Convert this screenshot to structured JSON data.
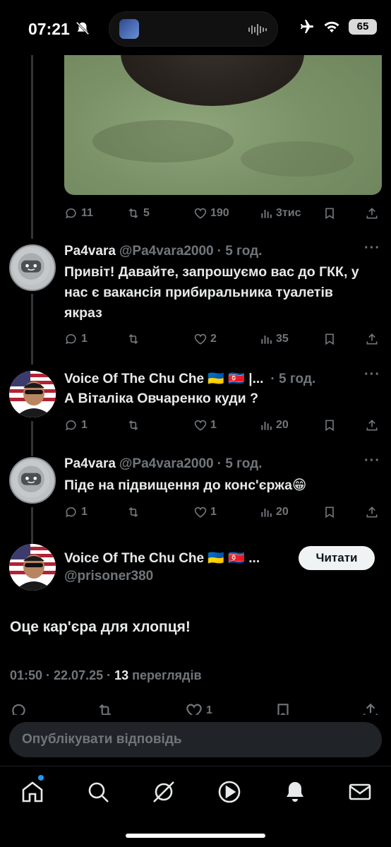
{
  "status_bar": {
    "time": "07:21",
    "battery": "65",
    "icons": [
      "bell-slash-icon",
      "airplane-icon",
      "wifi-icon",
      "battery-icon"
    ]
  },
  "colors": {
    "background": "#000000",
    "text_primary": "#e7e9ea",
    "text_secondary": "#71767b",
    "accent": "#1d9bf0"
  },
  "photo_post": {
    "actions": {
      "replies": "11",
      "reposts": "5",
      "likes": "190",
      "views": "3тис"
    }
  },
  "replies": [
    {
      "name": "Pa4vara",
      "handle": "@Pa4vara2000",
      "time": "· 5 год.",
      "text": "Привіт! Давайте, запрошуємо вас до ГКК, у нас є вакансія прибиральника туалетів якраз",
      "actions": {
        "replies": "1",
        "reposts": "",
        "likes": "2",
        "views": "35"
      }
    },
    {
      "name": "Voice Of The Chu Che 🇺🇦 🇰🇵 |...",
      "handle": "",
      "time": "· 5 год.",
      "text": "А Віталіка Овчаренко куди ?",
      "actions": {
        "replies": "1",
        "reposts": "",
        "likes": "1",
        "views": "20"
      }
    },
    {
      "name": "Pa4vara",
      "handle": "@Pa4vara2000",
      "time": "· 5 год.",
      "text": "Піде на підвищення до конс'єржа😁",
      "actions": {
        "replies": "1",
        "reposts": "",
        "likes": "1",
        "views": "20"
      }
    }
  ],
  "main_tweet": {
    "name": "Voice Of The Chu Che 🇺🇦 🇰🇵 ...",
    "handle": "@prisoner380",
    "follow_label": "Читати",
    "text": "Оце кар'єра для хлопця!",
    "timestamp": "01:50 · 22.07.25 · ",
    "views_count": "13",
    "views_label": " переглядів",
    "actions": {
      "likes": "1"
    }
  },
  "composer": {
    "placeholder": "Опублікувати відповідь"
  },
  "tabs": [
    "home-icon",
    "search-icon",
    "grok-icon",
    "video-icon",
    "notifications-icon",
    "messages-icon"
  ]
}
